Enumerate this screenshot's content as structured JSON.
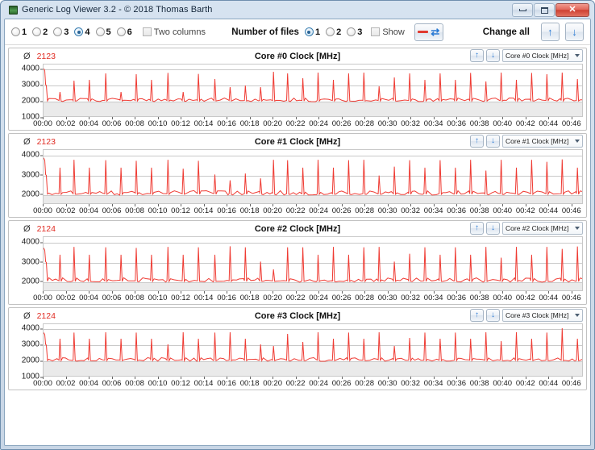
{
  "window": {
    "title": "Generic Log Viewer 3.2 - © 2018 Thomas Barth",
    "icon": "app-monitor-icon",
    "caption": {
      "minimize": "minimize-icon",
      "maximize": "maximize-icon",
      "close": "✕"
    }
  },
  "toolbar": {
    "panel_count_options": [
      "1",
      "2",
      "3",
      "4",
      "5",
      "6"
    ],
    "panel_count_selected": "4",
    "two_columns_label": "Two columns",
    "two_columns_checked": false,
    "number_of_files_label": "Number of files",
    "file_count_options": [
      "1",
      "2",
      "3"
    ],
    "file_count_selected": "1",
    "show_label": "Show",
    "show_checked": false,
    "line_style_button": "line-style-button",
    "change_all_label": "Change all",
    "up_arrow": "↑",
    "down_arrow": "↓",
    "refresh_glyph": "⇄"
  },
  "accent": {
    "series": "#ef3b33",
    "avg_text": "#e02b22",
    "grid": "#c9c9c9",
    "band": "#eaeaea",
    "blue": "#2a7ad4"
  },
  "chart_data": [
    {
      "type": "line",
      "title": "Core #0 Clock [MHz]",
      "avg_symbol": "Ø",
      "avg_value": "2123",
      "selector_value": "Core #0 Clock [MHz]",
      "ylabel": "",
      "xlabel": "",
      "yticks": [
        4000,
        3000,
        2000,
        1000
      ],
      "ylim": [
        1000,
        4300
      ],
      "grid": true,
      "xticks": [
        "00:00",
        "00:02",
        "00:04",
        "00:06",
        "00:08",
        "00:10",
        "00:12",
        "00:14",
        "00:16",
        "00:18",
        "00:20",
        "00:22",
        "00:24",
        "00:26",
        "00:28",
        "00:30",
        "00:32",
        "00:34",
        "00:36",
        "00:38",
        "00:40",
        "00:42",
        "00:44",
        "00:46"
      ],
      "xlim": [
        0,
        47
      ],
      "series": [
        {
          "name": "Core #0 Clock [MHz]",
          "color": "#ef3b33",
          "baseline": 2100,
          "start_peak": 4050,
          "spikes": [
            {
              "x": 0.2,
              "y": 4050
            },
            {
              "x": 1.4,
              "y": 2600
            },
            {
              "x": 2.6,
              "y": 3300
            },
            {
              "x": 3.9,
              "y": 3350
            },
            {
              "x": 5.3,
              "y": 3750
            },
            {
              "x": 6.6,
              "y": 2600
            },
            {
              "x": 7.9,
              "y": 3700
            },
            {
              "x": 9.2,
              "y": 3350
            },
            {
              "x": 10.6,
              "y": 3780
            },
            {
              "x": 11.9,
              "y": 2600
            },
            {
              "x": 13.2,
              "y": 3720
            },
            {
              "x": 14.6,
              "y": 3400
            },
            {
              "x": 15.9,
              "y": 2900
            },
            {
              "x": 17.2,
              "y": 3000
            },
            {
              "x": 18.5,
              "y": 2900
            },
            {
              "x": 19.6,
              "y": 3850
            },
            {
              "x": 20.8,
              "y": 3750
            },
            {
              "x": 22.1,
              "y": 3450
            },
            {
              "x": 23.4,
              "y": 3800
            },
            {
              "x": 24.7,
              "y": 3350
            },
            {
              "x": 26.0,
              "y": 3750
            },
            {
              "x": 27.3,
              "y": 3800
            },
            {
              "x": 28.6,
              "y": 2950
            },
            {
              "x": 29.9,
              "y": 3500
            },
            {
              "x": 31.2,
              "y": 3750
            },
            {
              "x": 32.5,
              "y": 3350
            },
            {
              "x": 33.8,
              "y": 3750
            },
            {
              "x": 35.1,
              "y": 3350
            },
            {
              "x": 36.4,
              "y": 3780
            },
            {
              "x": 37.7,
              "y": 3250
            },
            {
              "x": 39.0,
              "y": 3800
            },
            {
              "x": 40.3,
              "y": 3350
            },
            {
              "x": 41.6,
              "y": 3780
            },
            {
              "x": 42.9,
              "y": 3700
            },
            {
              "x": 44.2,
              "y": 3800
            },
            {
              "x": 45.5,
              "y": 3400
            }
          ]
        }
      ]
    },
    {
      "type": "line",
      "title": "Core #1 Clock [MHz]",
      "avg_symbol": "Ø",
      "avg_value": "2123",
      "selector_value": "Core #1 Clock [MHz]",
      "ylabel": "",
      "xlabel": "",
      "yticks": [
        4000,
        3000,
        2000
      ],
      "ylim": [
        1500,
        4300
      ],
      "grid": true,
      "xticks": [
        "00:00",
        "00:02",
        "00:04",
        "00:06",
        "00:08",
        "00:10",
        "00:12",
        "00:14",
        "00:16",
        "00:18",
        "00:20",
        "00:22",
        "00:24",
        "00:26",
        "00:28",
        "00:30",
        "00:32",
        "00:34",
        "00:36",
        "00:38",
        "00:40",
        "00:42",
        "00:44",
        "00:46"
      ],
      "xlim": [
        0,
        47
      ],
      "series": [
        {
          "name": "Core #1 Clock [MHz]",
          "color": "#ef3b33",
          "baseline": 2100,
          "start_peak": 3900,
          "spikes": [
            {
              "x": 0.2,
              "y": 3900
            },
            {
              "x": 1.4,
              "y": 3400
            },
            {
              "x": 2.6,
              "y": 3800
            },
            {
              "x": 3.9,
              "y": 3400
            },
            {
              "x": 5.3,
              "y": 3780
            },
            {
              "x": 6.6,
              "y": 3400
            },
            {
              "x": 7.9,
              "y": 3750
            },
            {
              "x": 9.2,
              "y": 3400
            },
            {
              "x": 10.6,
              "y": 3800
            },
            {
              "x": 11.9,
              "y": 3350
            },
            {
              "x": 13.2,
              "y": 3750
            },
            {
              "x": 14.6,
              "y": 3050
            },
            {
              "x": 15.9,
              "y": 2750
            },
            {
              "x": 17.2,
              "y": 3100
            },
            {
              "x": 18.5,
              "y": 2850
            },
            {
              "x": 19.6,
              "y": 3800
            },
            {
              "x": 20.8,
              "y": 3780
            },
            {
              "x": 22.1,
              "y": 3400
            },
            {
              "x": 23.4,
              "y": 3800
            },
            {
              "x": 24.7,
              "y": 3400
            },
            {
              "x": 26.0,
              "y": 3780
            },
            {
              "x": 27.3,
              "y": 3800
            },
            {
              "x": 28.6,
              "y": 3000
            },
            {
              "x": 29.9,
              "y": 3450
            },
            {
              "x": 31.2,
              "y": 3780
            },
            {
              "x": 32.5,
              "y": 3400
            },
            {
              "x": 33.8,
              "y": 3780
            },
            {
              "x": 35.1,
              "y": 3400
            },
            {
              "x": 36.4,
              "y": 3800
            },
            {
              "x": 37.7,
              "y": 3250
            },
            {
              "x": 39.0,
              "y": 3800
            },
            {
              "x": 40.3,
              "y": 3400
            },
            {
              "x": 41.6,
              "y": 3800
            },
            {
              "x": 42.9,
              "y": 3700
            },
            {
              "x": 44.2,
              "y": 3820
            },
            {
              "x": 45.5,
              "y": 3400
            }
          ]
        }
      ]
    },
    {
      "type": "line",
      "title": "Core #2 Clock [MHz]",
      "avg_symbol": "Ø",
      "avg_value": "2124",
      "selector_value": "Core #2 Clock [MHz]",
      "ylabel": "",
      "xlabel": "",
      "yticks": [
        4000,
        3000,
        2000
      ],
      "ylim": [
        1500,
        4300
      ],
      "grid": true,
      "xticks": [
        "00:00",
        "00:02",
        "00:04",
        "00:06",
        "00:08",
        "00:10",
        "00:12",
        "00:14",
        "00:16",
        "00:18",
        "00:20",
        "00:22",
        "00:24",
        "00:26",
        "00:28",
        "00:30",
        "00:32",
        "00:34",
        "00:36",
        "00:38",
        "00:40",
        "00:42",
        "00:44",
        "00:46"
      ],
      "xlim": [
        0,
        47
      ],
      "series": [
        {
          "name": "Core #2 Clock [MHz]",
          "color": "#ef3b33",
          "baseline": 2100,
          "start_peak": 3750,
          "spikes": [
            {
              "x": 0.2,
              "y": 3750
            },
            {
              "x": 1.4,
              "y": 3400
            },
            {
              "x": 2.6,
              "y": 3800
            },
            {
              "x": 3.9,
              "y": 3400
            },
            {
              "x": 5.3,
              "y": 3780
            },
            {
              "x": 6.6,
              "y": 3400
            },
            {
              "x": 7.9,
              "y": 3750
            },
            {
              "x": 9.2,
              "y": 3400
            },
            {
              "x": 10.6,
              "y": 3800
            },
            {
              "x": 11.9,
              "y": 3400
            },
            {
              "x": 13.2,
              "y": 3780
            },
            {
              "x": 14.6,
              "y": 3400
            },
            {
              "x": 15.9,
              "y": 3830
            },
            {
              "x": 17.2,
              "y": 3780
            },
            {
              "x": 18.5,
              "y": 3050
            },
            {
              "x": 19.6,
              "y": 2650
            },
            {
              "x": 20.8,
              "y": 3780
            },
            {
              "x": 22.1,
              "y": 3780
            },
            {
              "x": 23.4,
              "y": 3400
            },
            {
              "x": 24.7,
              "y": 3800
            },
            {
              "x": 26.0,
              "y": 3400
            },
            {
              "x": 27.3,
              "y": 3780
            },
            {
              "x": 28.6,
              "y": 3800
            },
            {
              "x": 29.9,
              "y": 3050
            },
            {
              "x": 31.2,
              "y": 3450
            },
            {
              "x": 32.5,
              "y": 3780
            },
            {
              "x": 33.8,
              "y": 3400
            },
            {
              "x": 35.1,
              "y": 3780
            },
            {
              "x": 36.4,
              "y": 3400
            },
            {
              "x": 37.7,
              "y": 3800
            },
            {
              "x": 39.0,
              "y": 3250
            },
            {
              "x": 40.3,
              "y": 3800
            },
            {
              "x": 41.6,
              "y": 3400
            },
            {
              "x": 42.9,
              "y": 3800
            },
            {
              "x": 44.2,
              "y": 3700
            },
            {
              "x": 45.5,
              "y": 3820
            }
          ]
        }
      ]
    },
    {
      "type": "line",
      "title": "Core #3 Clock [MHz]",
      "avg_symbol": "Ø",
      "avg_value": "2124",
      "selector_value": "Core #3 Clock [MHz]",
      "ylabel": "",
      "xlabel": "",
      "yticks": [
        4000,
        3000,
        2000,
        1000
      ],
      "ylim": [
        1000,
        4300
      ],
      "grid": true,
      "xticks": [
        "00:00",
        "00:02",
        "00:04",
        "00:06",
        "00:08",
        "00:10",
        "00:12",
        "00:14",
        "00:16",
        "00:18",
        "00:20",
        "00:22",
        "00:24",
        "00:26",
        "00:28",
        "00:30",
        "00:32",
        "00:34",
        "00:36",
        "00:38",
        "00:40",
        "00:42",
        "00:44",
        "00:46"
      ],
      "xlim": [
        0,
        47
      ],
      "series": [
        {
          "name": "Core #3 Clock [MHz]",
          "color": "#ef3b33",
          "baseline": 2100,
          "start_peak": 3780,
          "spikes": [
            {
              "x": 0.2,
              "y": 3780
            },
            {
              "x": 1.4,
              "y": 3400
            },
            {
              "x": 2.6,
              "y": 3780
            },
            {
              "x": 3.9,
              "y": 3400
            },
            {
              "x": 5.3,
              "y": 3800
            },
            {
              "x": 6.6,
              "y": 3400
            },
            {
              "x": 7.9,
              "y": 3780
            },
            {
              "x": 9.2,
              "y": 3400
            },
            {
              "x": 10.6,
              "y": 3050
            },
            {
              "x": 11.9,
              "y": 3800
            },
            {
              "x": 13.2,
              "y": 3400
            },
            {
              "x": 14.6,
              "y": 3780
            },
            {
              "x": 15.9,
              "y": 3800
            },
            {
              "x": 17.2,
              "y": 3400
            },
            {
              "x": 18.5,
              "y": 3050
            },
            {
              "x": 19.6,
              "y": 2950
            },
            {
              "x": 20.8,
              "y": 3700
            },
            {
              "x": 22.1,
              "y": 3200
            },
            {
              "x": 23.4,
              "y": 3800
            },
            {
              "x": 24.7,
              "y": 3400
            },
            {
              "x": 26.0,
              "y": 3780
            },
            {
              "x": 27.3,
              "y": 3400
            },
            {
              "x": 28.6,
              "y": 3800
            },
            {
              "x": 29.9,
              "y": 2950
            },
            {
              "x": 31.2,
              "y": 3450
            },
            {
              "x": 32.5,
              "y": 3780
            },
            {
              "x": 33.8,
              "y": 3400
            },
            {
              "x": 35.1,
              "y": 3780
            },
            {
              "x": 36.4,
              "y": 3400
            },
            {
              "x": 37.7,
              "y": 3800
            },
            {
              "x": 39.0,
              "y": 3250
            },
            {
              "x": 40.3,
              "y": 3800
            },
            {
              "x": 41.6,
              "y": 3400
            },
            {
              "x": 42.9,
              "y": 3780
            },
            {
              "x": 44.2,
              "y": 4050
            },
            {
              "x": 45.5,
              "y": 3400
            }
          ]
        }
      ]
    }
  ]
}
